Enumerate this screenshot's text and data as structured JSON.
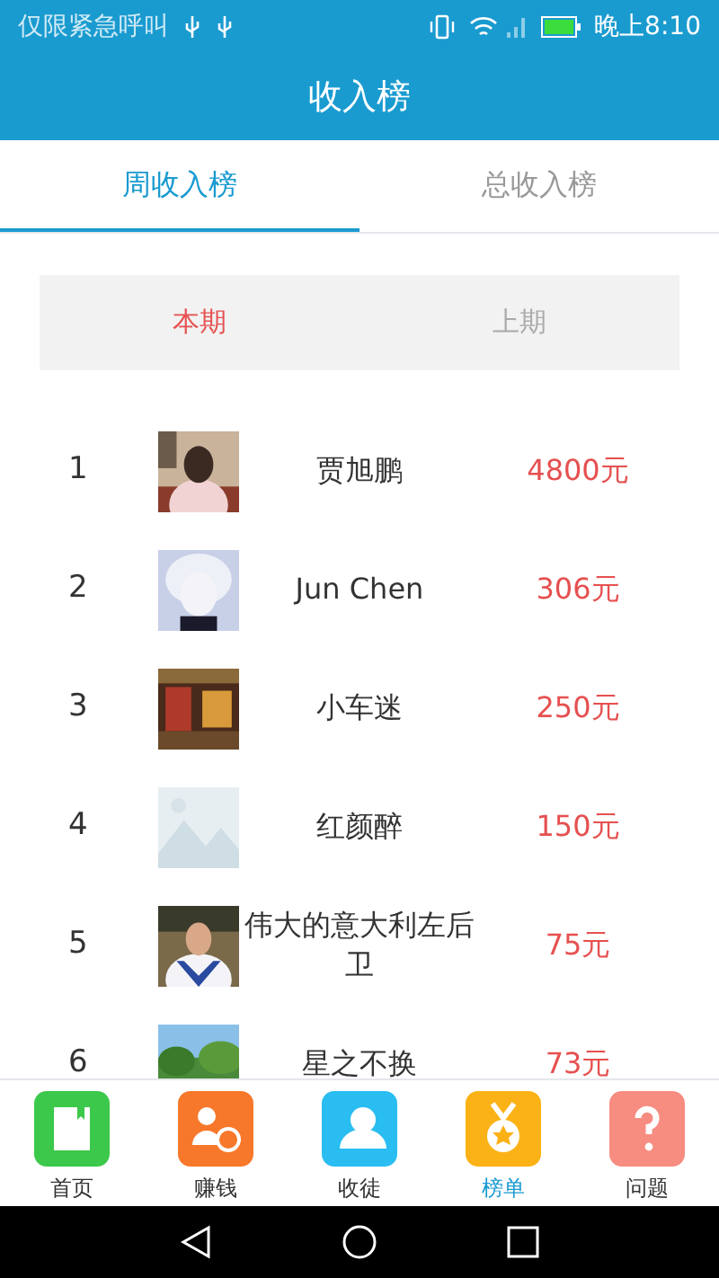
{
  "status_bar": {
    "carrier": "仅限紧急呼叫",
    "time": "晚上8:10"
  },
  "title": "收入榜",
  "tabs": [
    {
      "label": "周收入榜",
      "selected": true
    },
    {
      "label": "总收入榜",
      "selected": false
    }
  ],
  "period_tabs": [
    {
      "label": "本期",
      "selected": true
    },
    {
      "label": "上期",
      "selected": false
    }
  ],
  "ranking": [
    {
      "rank": "1",
      "name": "贾旭鹏",
      "amount": "4800元"
    },
    {
      "rank": "2",
      "name": "Jun Chen",
      "amount": "306元"
    },
    {
      "rank": "3",
      "name": "小车迷",
      "amount": "250元"
    },
    {
      "rank": "4",
      "name": "红颜醉",
      "amount": "150元"
    },
    {
      "rank": "5",
      "name": "伟大的意大利左后卫",
      "amount": "75元"
    },
    {
      "rank": "6",
      "name": "星之不换",
      "amount": "73元"
    }
  ],
  "bottom_nav": [
    {
      "label": "首页",
      "color": "#3cc84a",
      "selected": false
    },
    {
      "label": "赚钱",
      "color": "#f7782a",
      "selected": false
    },
    {
      "label": "收徒",
      "color": "#29bdf2",
      "selected": false
    },
    {
      "label": "榜单",
      "color": "#fbb217",
      "selected": true
    },
    {
      "label": "问题",
      "color": "#f78c80",
      "selected": false
    }
  ]
}
